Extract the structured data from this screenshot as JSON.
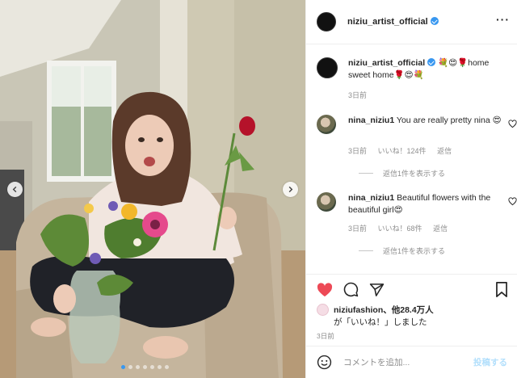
{
  "photo": {
    "alt_icons": {
      "prev": "chevron-left-icon",
      "next": "chevron-right-icon"
    },
    "dots_count": 7,
    "active_dot": 0
  },
  "post": {
    "username": "niziu_artist_official",
    "caption_user": "niziu_artist_official",
    "caption_text": " 💐😍🌹home sweet home🌹😍💐",
    "caption_time": "3日前"
  },
  "comments": [
    {
      "user": "nina_niziu1",
      "text": " You are really pretty nina 😍",
      "time": "3日前",
      "likes": "いいね！124件",
      "reply": "返信",
      "view_replies": "返信1件を表示する"
    },
    {
      "user": "nina_niziu1",
      "text": " Beautiful flowers with the beautiful girl😍",
      "time": "3日前",
      "likes": "いいね！68件",
      "reply": "返信",
      "view_replies": "返信1件を表示する"
    }
  ],
  "likes_summary": {
    "user": "niziufashion",
    "rest": "、他28.4万人",
    "line2": "が「いいね！」しました"
  },
  "post_date": "3日前",
  "comment_input": {
    "placeholder": "コメントを追加...",
    "post_label": "投稿する"
  },
  "colors": {
    "accent": "#3897f0",
    "like": "#ed4956",
    "muted": "#8e8e8e"
  }
}
